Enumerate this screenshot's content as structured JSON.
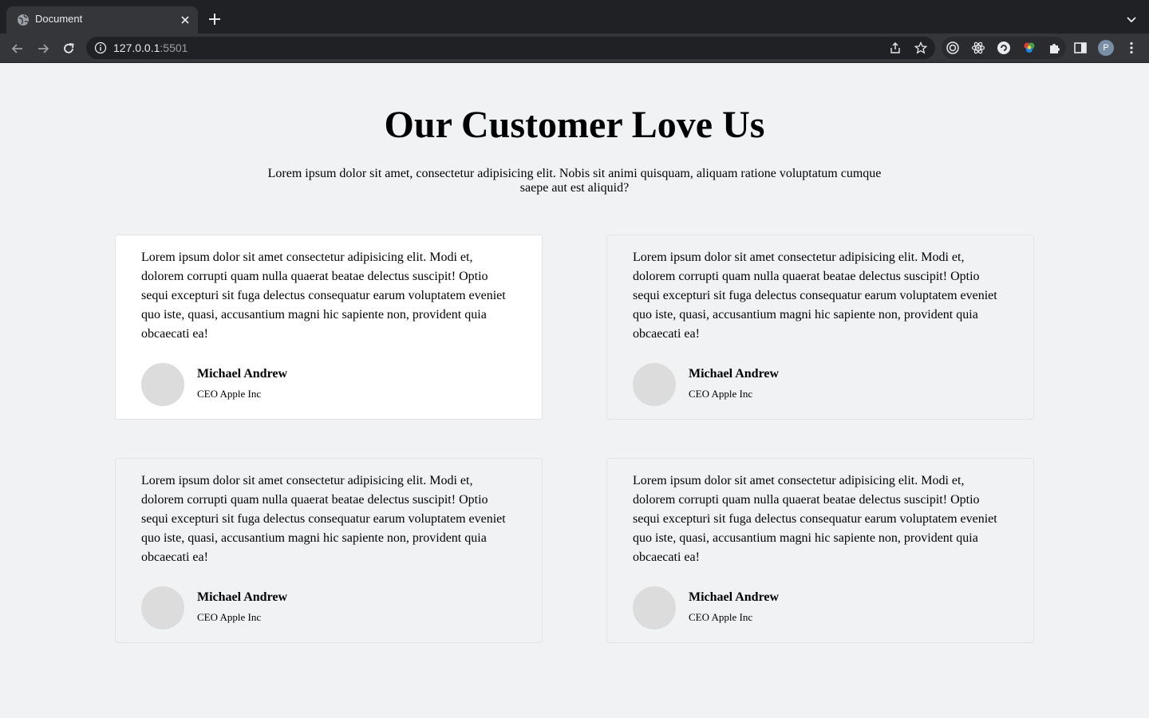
{
  "browser": {
    "tab_title": "Document",
    "url_host": "127.0.0.1",
    "url_port": ":5501",
    "avatar_letter": "P"
  },
  "page": {
    "heading": "Our Customer Love Us",
    "subheading": "Lorem ipsum dolor sit amet, consectetur adipisicing elit. Nobis sit animi quisquam, aliquam ratione voluptatum cumque saepe aut est aliquid?"
  },
  "testimonials": [
    {
      "text": "Lorem ipsum dolor sit amet consectetur adipisicing elit. Modi et, dolorem corrupti quam nulla quaerat beatae delectus suscipit! Optio sequi excepturi sit fuga delectus consequatur earum voluptatem eveniet quo iste, quasi, accusantium magni hic sapiente non, provident quia obcaecati ea!",
      "name": "Michael Andrew",
      "role": "CEO Apple Inc"
    },
    {
      "text": "Lorem ipsum dolor sit amet consectetur adipisicing elit. Modi et, dolorem corrupti quam nulla quaerat beatae delectus suscipit! Optio sequi excepturi sit fuga delectus consequatur earum voluptatem eveniet quo iste, quasi, accusantium magni hic sapiente non, provident quia obcaecati ea!",
      "name": "Michael Andrew",
      "role": "CEO Apple Inc"
    },
    {
      "text": "Lorem ipsum dolor sit amet consectetur adipisicing elit. Modi et, dolorem corrupti quam nulla quaerat beatae delectus suscipit! Optio sequi excepturi sit fuga delectus consequatur earum voluptatem eveniet quo iste, quasi, accusantium magni hic sapiente non, provident quia obcaecati ea!",
      "name": "Michael Andrew",
      "role": "CEO Apple Inc"
    },
    {
      "text": "Lorem ipsum dolor sit amet consectetur adipisicing elit. Modi et, dolorem corrupti quam nulla quaerat beatae delectus suscipit! Optio sequi excepturi sit fuga delectus consequatur earum voluptatem eveniet quo iste, quasi, accusantium magni hic sapiente non, provident quia obcaecati ea!",
      "name": "Michael Andrew",
      "role": "CEO Apple Inc"
    }
  ]
}
